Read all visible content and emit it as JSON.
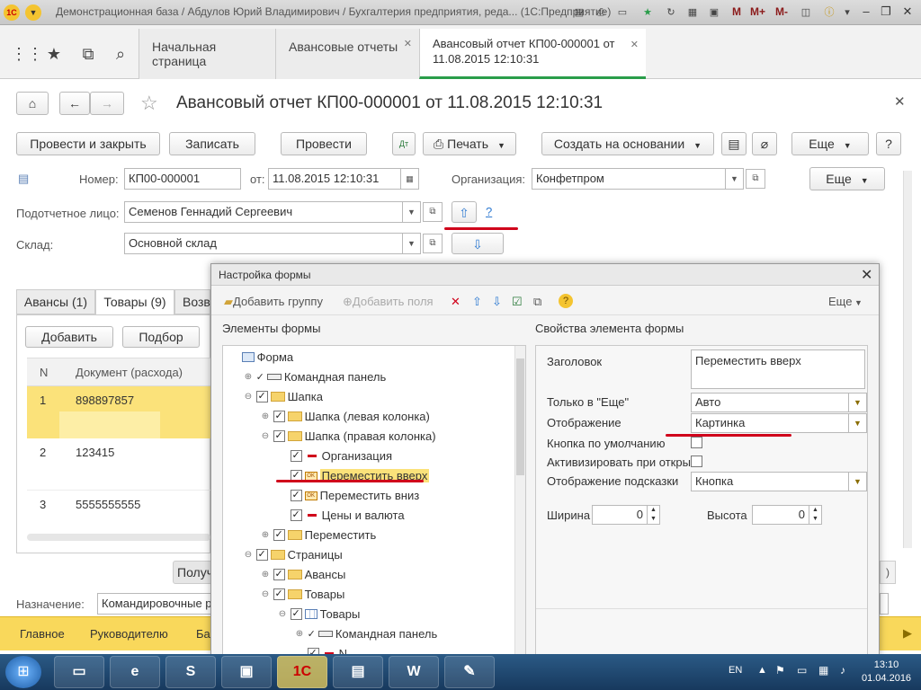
{
  "window": {
    "title": "Демонстрационная база / Абдулов Юрий Владимирович / Бухгалтерия предприятия, реда... (1С:Предприятие)",
    "toolbar_labels": [
      "M",
      "M+",
      "M-"
    ]
  },
  "tabs": [
    {
      "label": "Начальная страница"
    },
    {
      "label": "Авансовые отчеты"
    },
    {
      "label": "Авансовый отчет КП00-000001 от",
      "label2": "11.08.2015 12:10:31"
    }
  ],
  "document": {
    "title": "Авансовый отчет КП00-000001 от 11.08.2015 12:10:31",
    "buttons": {
      "post_close": "Провести и закрыть",
      "save": "Записать",
      "post": "Провести",
      "print": "Печать",
      "create_based": "Создать на основании",
      "more": "Еще",
      "help": "?",
      "more2": "Еще"
    },
    "fields": {
      "number_label": "Номер:",
      "number_value": "КП00-000001",
      "date_label": "от:",
      "date_value": "11.08.2015 12:10:31",
      "org_label": "Организация:",
      "org_value": "Конфетпром",
      "person_label": "Подотчетное лицо:",
      "person_value": "Семенов Геннадий Сергеевич",
      "warehouse_label": "Склад:",
      "warehouse_value": "Основной склад",
      "question": "?"
    },
    "subtabs": [
      "Авансы (1)",
      "Товары (9)",
      "Возв"
    ],
    "table_buttons": {
      "add": "Добавить",
      "pick": "Подбор"
    },
    "table_headers": {
      "n": "N",
      "doc": "Документ (расхода)"
    },
    "rows": [
      {
        "n": "1",
        "doc": "898897857"
      },
      {
        "n": "2",
        "doc": "123415"
      },
      {
        "n": "3",
        "doc": "5555555555"
      }
    ],
    "purpose_label": "Назначение:",
    "purpose_value": "Командировочные р",
    "receive_label": "Получ",
    "bottom_nav": [
      "Главное",
      "Руководителю",
      "Ба"
    ]
  },
  "dialog": {
    "title": "Настройка формы",
    "toolbar": {
      "add_group": "Добавить группу",
      "add_fields": "Добавить поля",
      "more": "Еще"
    },
    "left_header": "Элементы формы",
    "right_header": "Свойства элемента формы",
    "tree": [
      {
        "label": "Форма",
        "level": 0,
        "icon": "form",
        "exp": "",
        "check": false
      },
      {
        "label": "Командная панель",
        "level": 1,
        "icon": "cmd",
        "exp": "+",
        "check": "tick"
      },
      {
        "label": "Шапка",
        "level": 1,
        "icon": "folder",
        "exp": "-",
        "check": true
      },
      {
        "label": "Шапка (левая колонка)",
        "level": 2,
        "icon": "folder",
        "exp": "+",
        "check": true
      },
      {
        "label": "Шапка (правая колонка)",
        "level": 2,
        "icon": "folder",
        "exp": "-",
        "check": true
      },
      {
        "label": "Организация",
        "level": 3,
        "icon": "field",
        "exp": "",
        "check": true
      },
      {
        "label": "Переместить вверх",
        "level": 3,
        "icon": "ok",
        "exp": "",
        "check": true,
        "selected": true
      },
      {
        "label": "Переместить вниз",
        "level": 3,
        "icon": "ok",
        "exp": "",
        "check": true
      },
      {
        "label": "Цены и валюта",
        "level": 3,
        "icon": "field",
        "exp": "",
        "check": true
      },
      {
        "label": "Переместить",
        "level": 2,
        "icon": "folder",
        "exp": "+",
        "check": true
      },
      {
        "label": "Страницы",
        "level": 1,
        "icon": "folder",
        "exp": "-",
        "check": true
      },
      {
        "label": "Авансы",
        "level": 2,
        "icon": "folder",
        "exp": "+",
        "check": true
      },
      {
        "label": "Товары",
        "level": 2,
        "icon": "folder",
        "exp": "-",
        "check": true
      },
      {
        "label": "Товары",
        "level": 3,
        "icon": "table",
        "exp": "-",
        "check": true
      },
      {
        "label": "Командная панель",
        "level": 4,
        "icon": "cmd",
        "exp": "+",
        "check": "tick"
      },
      {
        "label": "N",
        "level": 4,
        "icon": "field",
        "exp": "",
        "check": true
      }
    ],
    "props": {
      "caption_label": "Заголовок",
      "caption_value": "Переместить вверх",
      "only_more_label": "Только в \"Еще\"",
      "only_more_value": "Авто",
      "display_label": "Отображение",
      "display_value": "Картинка",
      "default_btn_label": "Кнопка по умолчанию",
      "activate_label": "Активизировать при откры",
      "tooltip_label": "Отображение подсказки",
      "tooltip_value": "Кнопка",
      "width_label": "Ширина",
      "width_value": "0",
      "height_label": "Высота",
      "height_value": "0"
    }
  },
  "taskbar": {
    "lang": "EN",
    "time": "13:10",
    "date": "01.04.2016"
  },
  "colors": {
    "accent_green": "#2a9d4a",
    "highlight_yellow": "#f9d85b",
    "annotation_red": "#d0021b"
  }
}
